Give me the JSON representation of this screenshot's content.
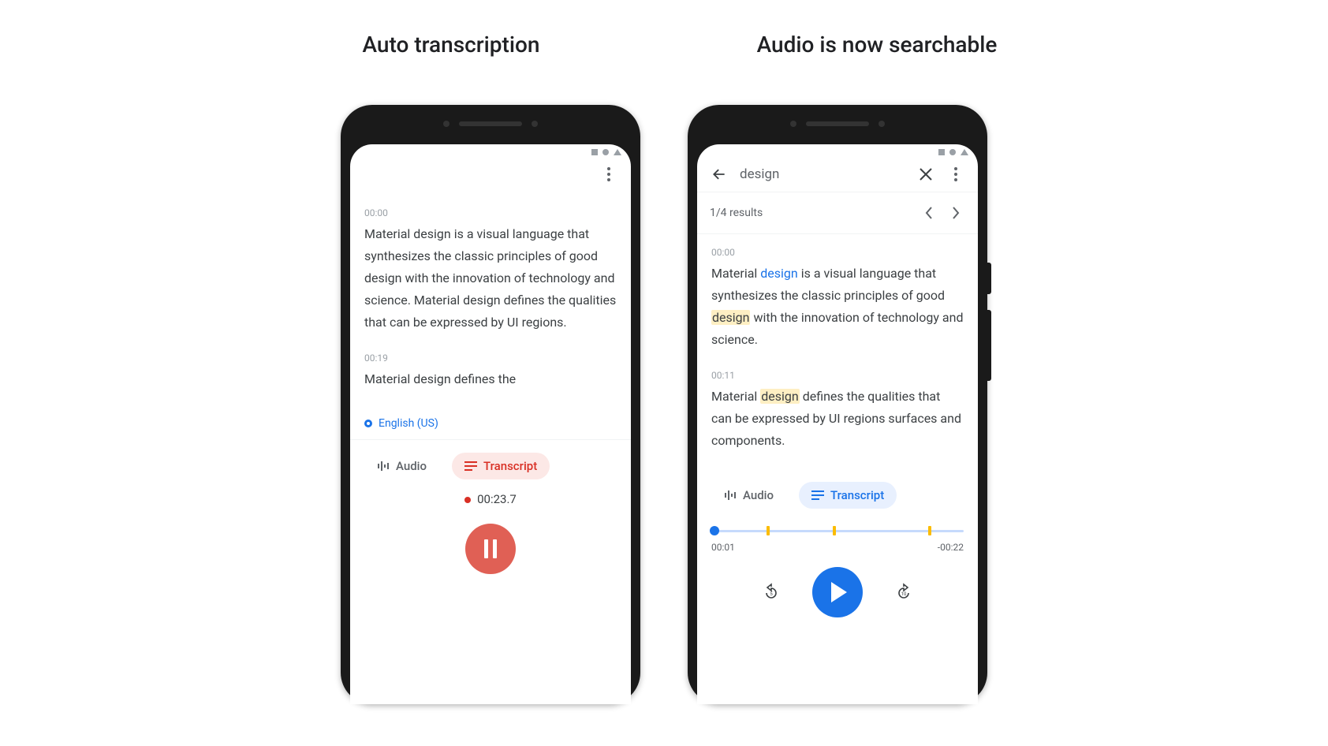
{
  "headings": {
    "left": "Auto transcription",
    "right": "Audio is now searchable"
  },
  "left": {
    "segments": [
      {
        "ts": "00:00",
        "text": "Material design is a visual language that synthesizes the classic principles of good design with the innovation of technology and science. Material design defines the qualities that can be expressed by UI regions."
      },
      {
        "ts": "00:19",
        "text": "Material design defines the"
      }
    ],
    "language": "English (US)",
    "tabs": {
      "audio": "Audio",
      "transcript": "Transcript"
    },
    "rec_time": "00:23.7"
  },
  "right": {
    "search_query": "design",
    "results_label": "1/4 results",
    "segments": [
      {
        "ts": "00:00",
        "pre1": "Material ",
        "hl1": "design",
        "mid": " is a visual language that synthesizes the classic principles of good ",
        "hl2": "design",
        "post": " with the innovation of technology and science."
      },
      {
        "ts": "00:11",
        "pre1": "Material ",
        "hl1": "design",
        "post": " defines the qualities that can be expressed by UI regions surfaces and components."
      }
    ],
    "tabs": {
      "audio": "Audio",
      "transcript": "Transcript"
    },
    "seek": {
      "current": "00:01",
      "remaining": "-00:22"
    }
  }
}
